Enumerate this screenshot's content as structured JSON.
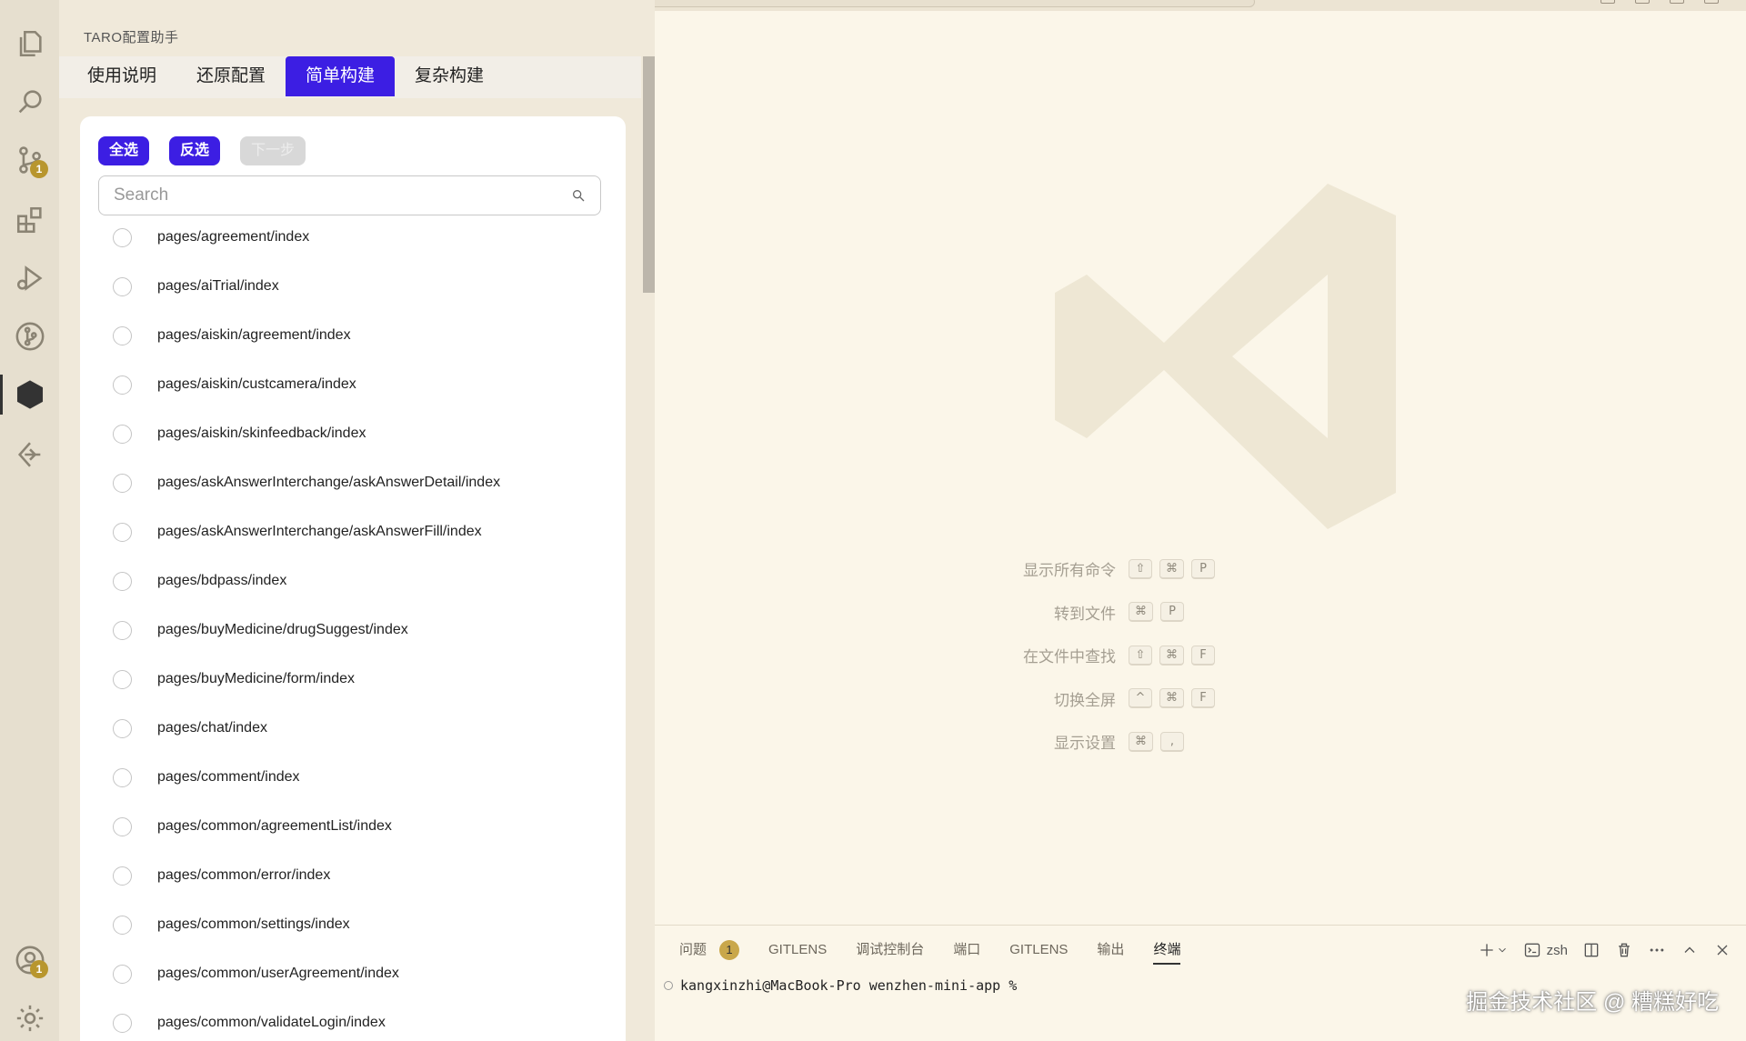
{
  "sidebar": {
    "title": "TARO配置助手",
    "tabs": [
      {
        "label": "使用说明",
        "active": false
      },
      {
        "label": "还原配置",
        "active": false
      },
      {
        "label": "简单构建",
        "active": true
      },
      {
        "label": "复杂构建",
        "active": false
      }
    ],
    "buttons": {
      "select_all": "全选",
      "invert": "反选",
      "next": "下一步"
    },
    "search": {
      "placeholder": "Search",
      "value": ""
    },
    "pages": [
      "pages/agreement/index",
      "pages/aiTrial/index",
      "pages/aiskin/agreement/index",
      "pages/aiskin/custcamera/index",
      "pages/aiskin/skinfeedback/index",
      "pages/askAnswerInterchange/askAnswerDetail/index",
      "pages/askAnswerInterchange/askAnswerFill/index",
      "pages/bdpass/index",
      "pages/buyMedicine/drugSuggest/index",
      "pages/buyMedicine/form/index",
      "pages/chat/index",
      "pages/comment/index",
      "pages/common/agreementList/index",
      "pages/common/error/index",
      "pages/common/settings/index",
      "pages/common/userAgreement/index",
      "pages/common/validateLogin/index"
    ]
  },
  "activity_bar": {
    "items": [
      {
        "icon": "explorer-icon"
      },
      {
        "icon": "search-icon"
      },
      {
        "icon": "source-control-icon",
        "badge": "1"
      },
      {
        "icon": "extensions-icon"
      },
      {
        "icon": "run-debug-icon"
      },
      {
        "icon": "git-graph-icon"
      },
      {
        "icon": "taro-cube-icon",
        "active": true
      },
      {
        "icon": "remote-icon"
      }
    ],
    "bottom": [
      {
        "icon": "account-icon",
        "badge": "1"
      },
      {
        "icon": "settings-gear-icon"
      }
    ]
  },
  "editor": {
    "shortcuts": [
      {
        "label": "显示所有命令",
        "keys": [
          "⇧",
          "⌘",
          "P"
        ]
      },
      {
        "label": "转到文件",
        "keys": [
          "⌘",
          "P"
        ]
      },
      {
        "label": "在文件中查找",
        "keys": [
          "⇧",
          "⌘",
          "F"
        ]
      },
      {
        "label": "切换全屏",
        "keys": [
          "^",
          "⌘",
          "F"
        ]
      },
      {
        "label": "显示设置",
        "keys": [
          "⌘",
          ","
        ]
      }
    ]
  },
  "panel": {
    "tabs": [
      {
        "label": "问题",
        "badge": "1"
      },
      {
        "label": "GITLENS"
      },
      {
        "label": "调试控制台"
      },
      {
        "label": "端口"
      },
      {
        "label": "GITLENS"
      },
      {
        "label": "输出"
      },
      {
        "label": "终端",
        "active": true
      }
    ],
    "shell": "zsh",
    "terminal_line": "kangxinzhi@MacBook-Pro wenzhen-mini-app %"
  },
  "watermark": "掘金技术社区 @ 糟糕好吃",
  "colors": {
    "accent": "#3c1ee3",
    "badge": "#b8962e",
    "background": "#fbf6e9"
  }
}
